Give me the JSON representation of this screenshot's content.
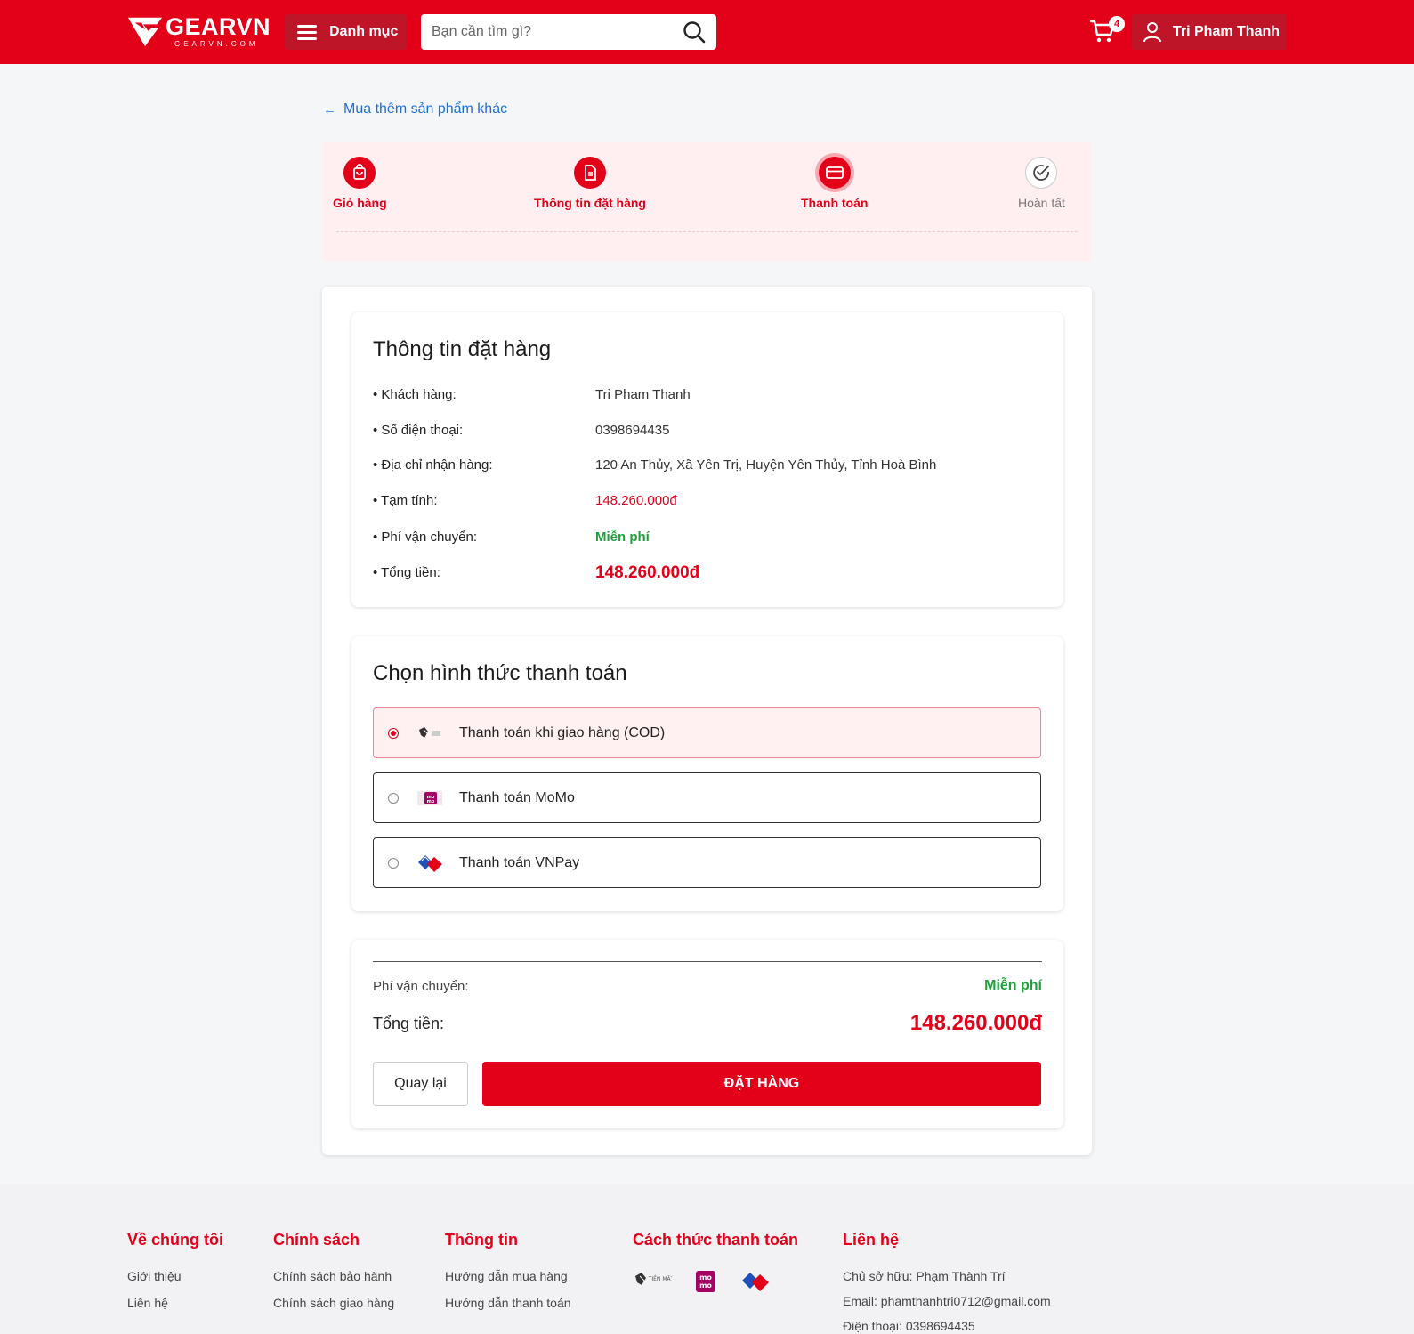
{
  "header": {
    "logo_text": "GEARVN",
    "logo_sub": "GEARVN.COM",
    "category_label": "Danh mục",
    "search_placeholder": "Bạn cần tìm gì?",
    "cart_count": "4",
    "user_name": "Tri Pham Thanh"
  },
  "back_link": "Mua thêm sản phẩm khác",
  "steps": [
    {
      "label": "Giỏ hàng",
      "state": "done",
      "icon": "bag-icon"
    },
    {
      "label": "Thông tin đặt hàng",
      "state": "done",
      "icon": "document-icon"
    },
    {
      "label": "Thanh toán",
      "state": "active",
      "icon": "card-icon"
    },
    {
      "label": "Hoàn tất",
      "state": "pending",
      "icon": "check-circle-icon"
    }
  ],
  "order_info": {
    "title": "Thông tin đặt hàng",
    "rows": [
      {
        "label": "• Khách hàng:",
        "value": "Tri Pham Thanh"
      },
      {
        "label": "• Số điện thoại:",
        "value": "0398694435"
      },
      {
        "label": "• Địa chỉ nhận hàng:",
        "value": "120 An Thủy, Xã Yên Trị, Huyện Yên Thủy, Tỉnh Hoà Bình"
      },
      {
        "label": "• Tạm tính:",
        "value": "148.260.000đ"
      },
      {
        "label": "• Phí vận chuyển:",
        "value": "Miễn phí"
      },
      {
        "label": "• Tổng tiền:",
        "value": "148.260.000đ"
      }
    ]
  },
  "payment": {
    "title": "Chọn hình thức thanh toán",
    "options": [
      {
        "label": "Thanh toán khi giao hàng (COD)",
        "selected": true,
        "icon": "cash-icon"
      },
      {
        "label": "Thanh toán MoMo",
        "selected": false,
        "icon": "momo-icon"
      },
      {
        "label": "Thanh toán VNPay",
        "selected": false,
        "icon": "vnpay-icon"
      }
    ]
  },
  "summary": {
    "shipping_label": "Phí vận chuyển:",
    "shipping_value": "Miễn phí",
    "total_label": "Tổng tiền:",
    "total_value": "148.260.000đ",
    "back_button": "Quay lại",
    "order_button": "ĐẶT HÀNG"
  },
  "footer": {
    "about": {
      "title": "Về chúng tôi",
      "links": [
        "Giới thiệu",
        "Liên hệ"
      ]
    },
    "policy": {
      "title": "Chính sách",
      "links": [
        "Chính sách bảo hành",
        "Chính sách giao hàng"
      ]
    },
    "info": {
      "title": "Thông tin",
      "links": [
        "Hướng dẫn mua hàng",
        "Hướng dẫn thanh toán"
      ]
    },
    "payment_methods": {
      "title": "Cách thức thanh toán",
      "cash_caption": "TIỀN MẶT"
    },
    "contact": {
      "title": "Liên hệ",
      "lines": [
        "Chủ sở hữu: Phạm Thành Trí",
        "Email: phamthanhtri0712@gmail.com",
        "Điện thoại: 0398694435"
      ]
    }
  },
  "colors": {
    "brand": "#e30019",
    "dark_brand": "#be1529",
    "success": "#1ea13d",
    "link": "#1e6fd9"
  }
}
